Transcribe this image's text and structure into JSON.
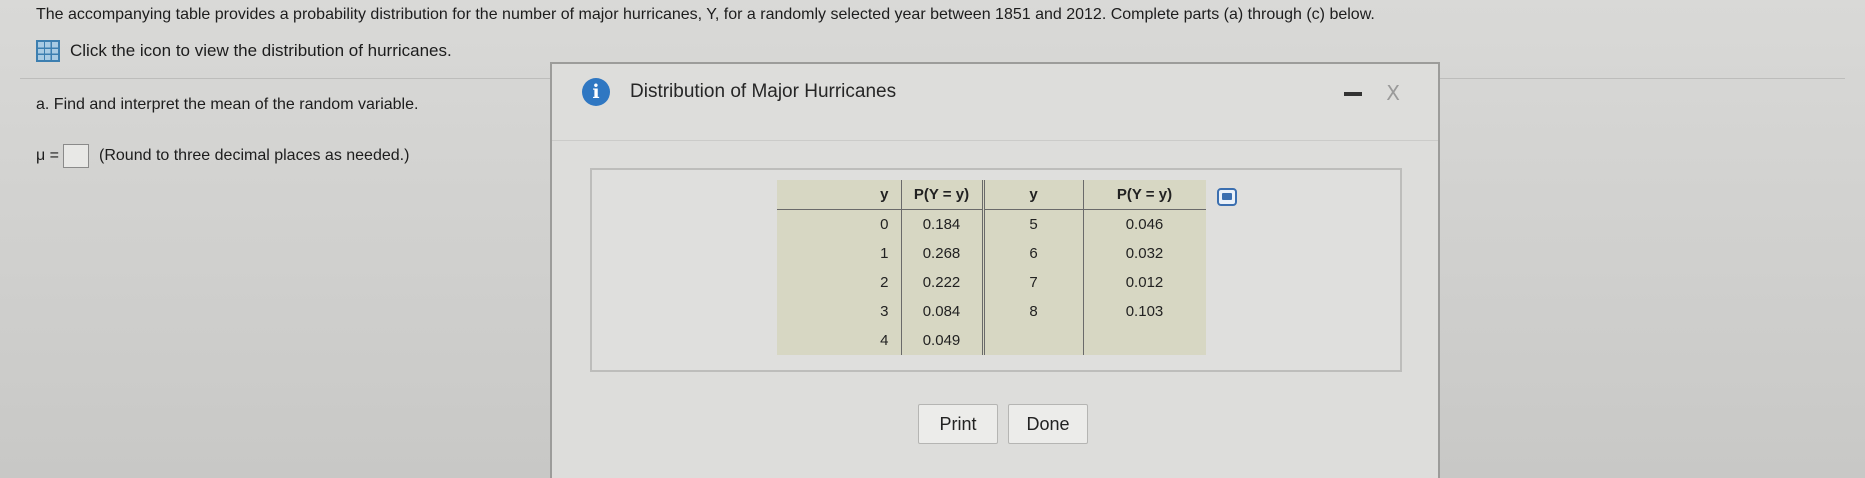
{
  "question": {
    "text": "The accompanying table provides a probability distribution for the number of major hurricanes, Y, for a randomly selected year between 1851 and 2012. Complete parts (a) through (c) below.",
    "icon_link_label": "Click the icon to view the distribution of hurricanes.",
    "part_a": "a. Find and interpret the mean of the random variable.",
    "mu_label": "μ =",
    "mu_hint": "(Round to three decimal places as needed.)",
    "mu_value": ""
  },
  "dialog": {
    "info_icon": "i",
    "title": "Distribution of Major Hurricanes",
    "close_glyph": "X",
    "print_label": "Print",
    "done_label": "Done"
  },
  "table": {
    "headers": [
      "y",
      "P(Y = y)",
      "y",
      "P(Y = y)"
    ],
    "rows": [
      [
        "0",
        "0.184",
        "5",
        "0.046"
      ],
      [
        "1",
        "0.268",
        "6",
        "0.032"
      ],
      [
        "2",
        "0.222",
        "7",
        "0.012"
      ],
      [
        "3",
        "0.084",
        "8",
        "0.103"
      ],
      [
        "4",
        "0.049",
        "",
        ""
      ]
    ]
  },
  "icons": {
    "grid": "table-grid-icon",
    "info": "info-icon",
    "copy": "copy-icon",
    "minimize": "minimize-icon",
    "close": "close-icon"
  },
  "colors": {
    "table_fill": "#d7d7c3",
    "info_blue": "#2f77c2"
  }
}
